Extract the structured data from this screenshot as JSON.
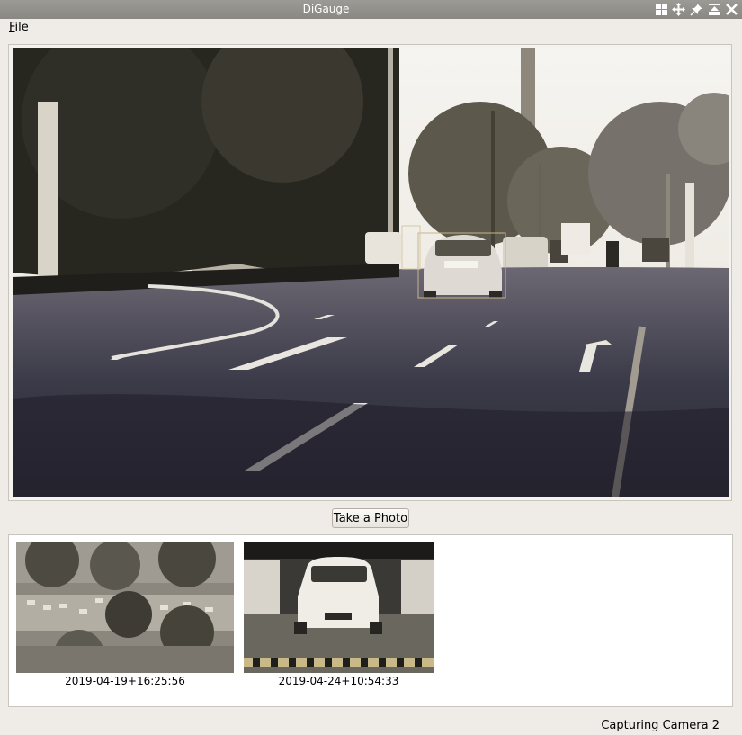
{
  "window": {
    "title": "DiGauge"
  },
  "titlebar_icons": [
    "tile-icon",
    "move-icon",
    "pin-icon",
    "maximize-icon",
    "close-icon"
  ],
  "menu": {
    "file_label": "File"
  },
  "camera_feed": {
    "detection_boxes": 2
  },
  "actions": {
    "take_photo_label": "Take a Photo"
  },
  "gallery": {
    "items": [
      {
        "timestamp": "2019-04-19+16:25:56"
      },
      {
        "timestamp": "2019-04-24+10:54:33"
      }
    ]
  },
  "status": {
    "text": "Capturing Camera 2"
  },
  "colors": {
    "background": "#efebe7",
    "titlebar": "#8f8d88",
    "detection_box": "#c8b58a"
  }
}
